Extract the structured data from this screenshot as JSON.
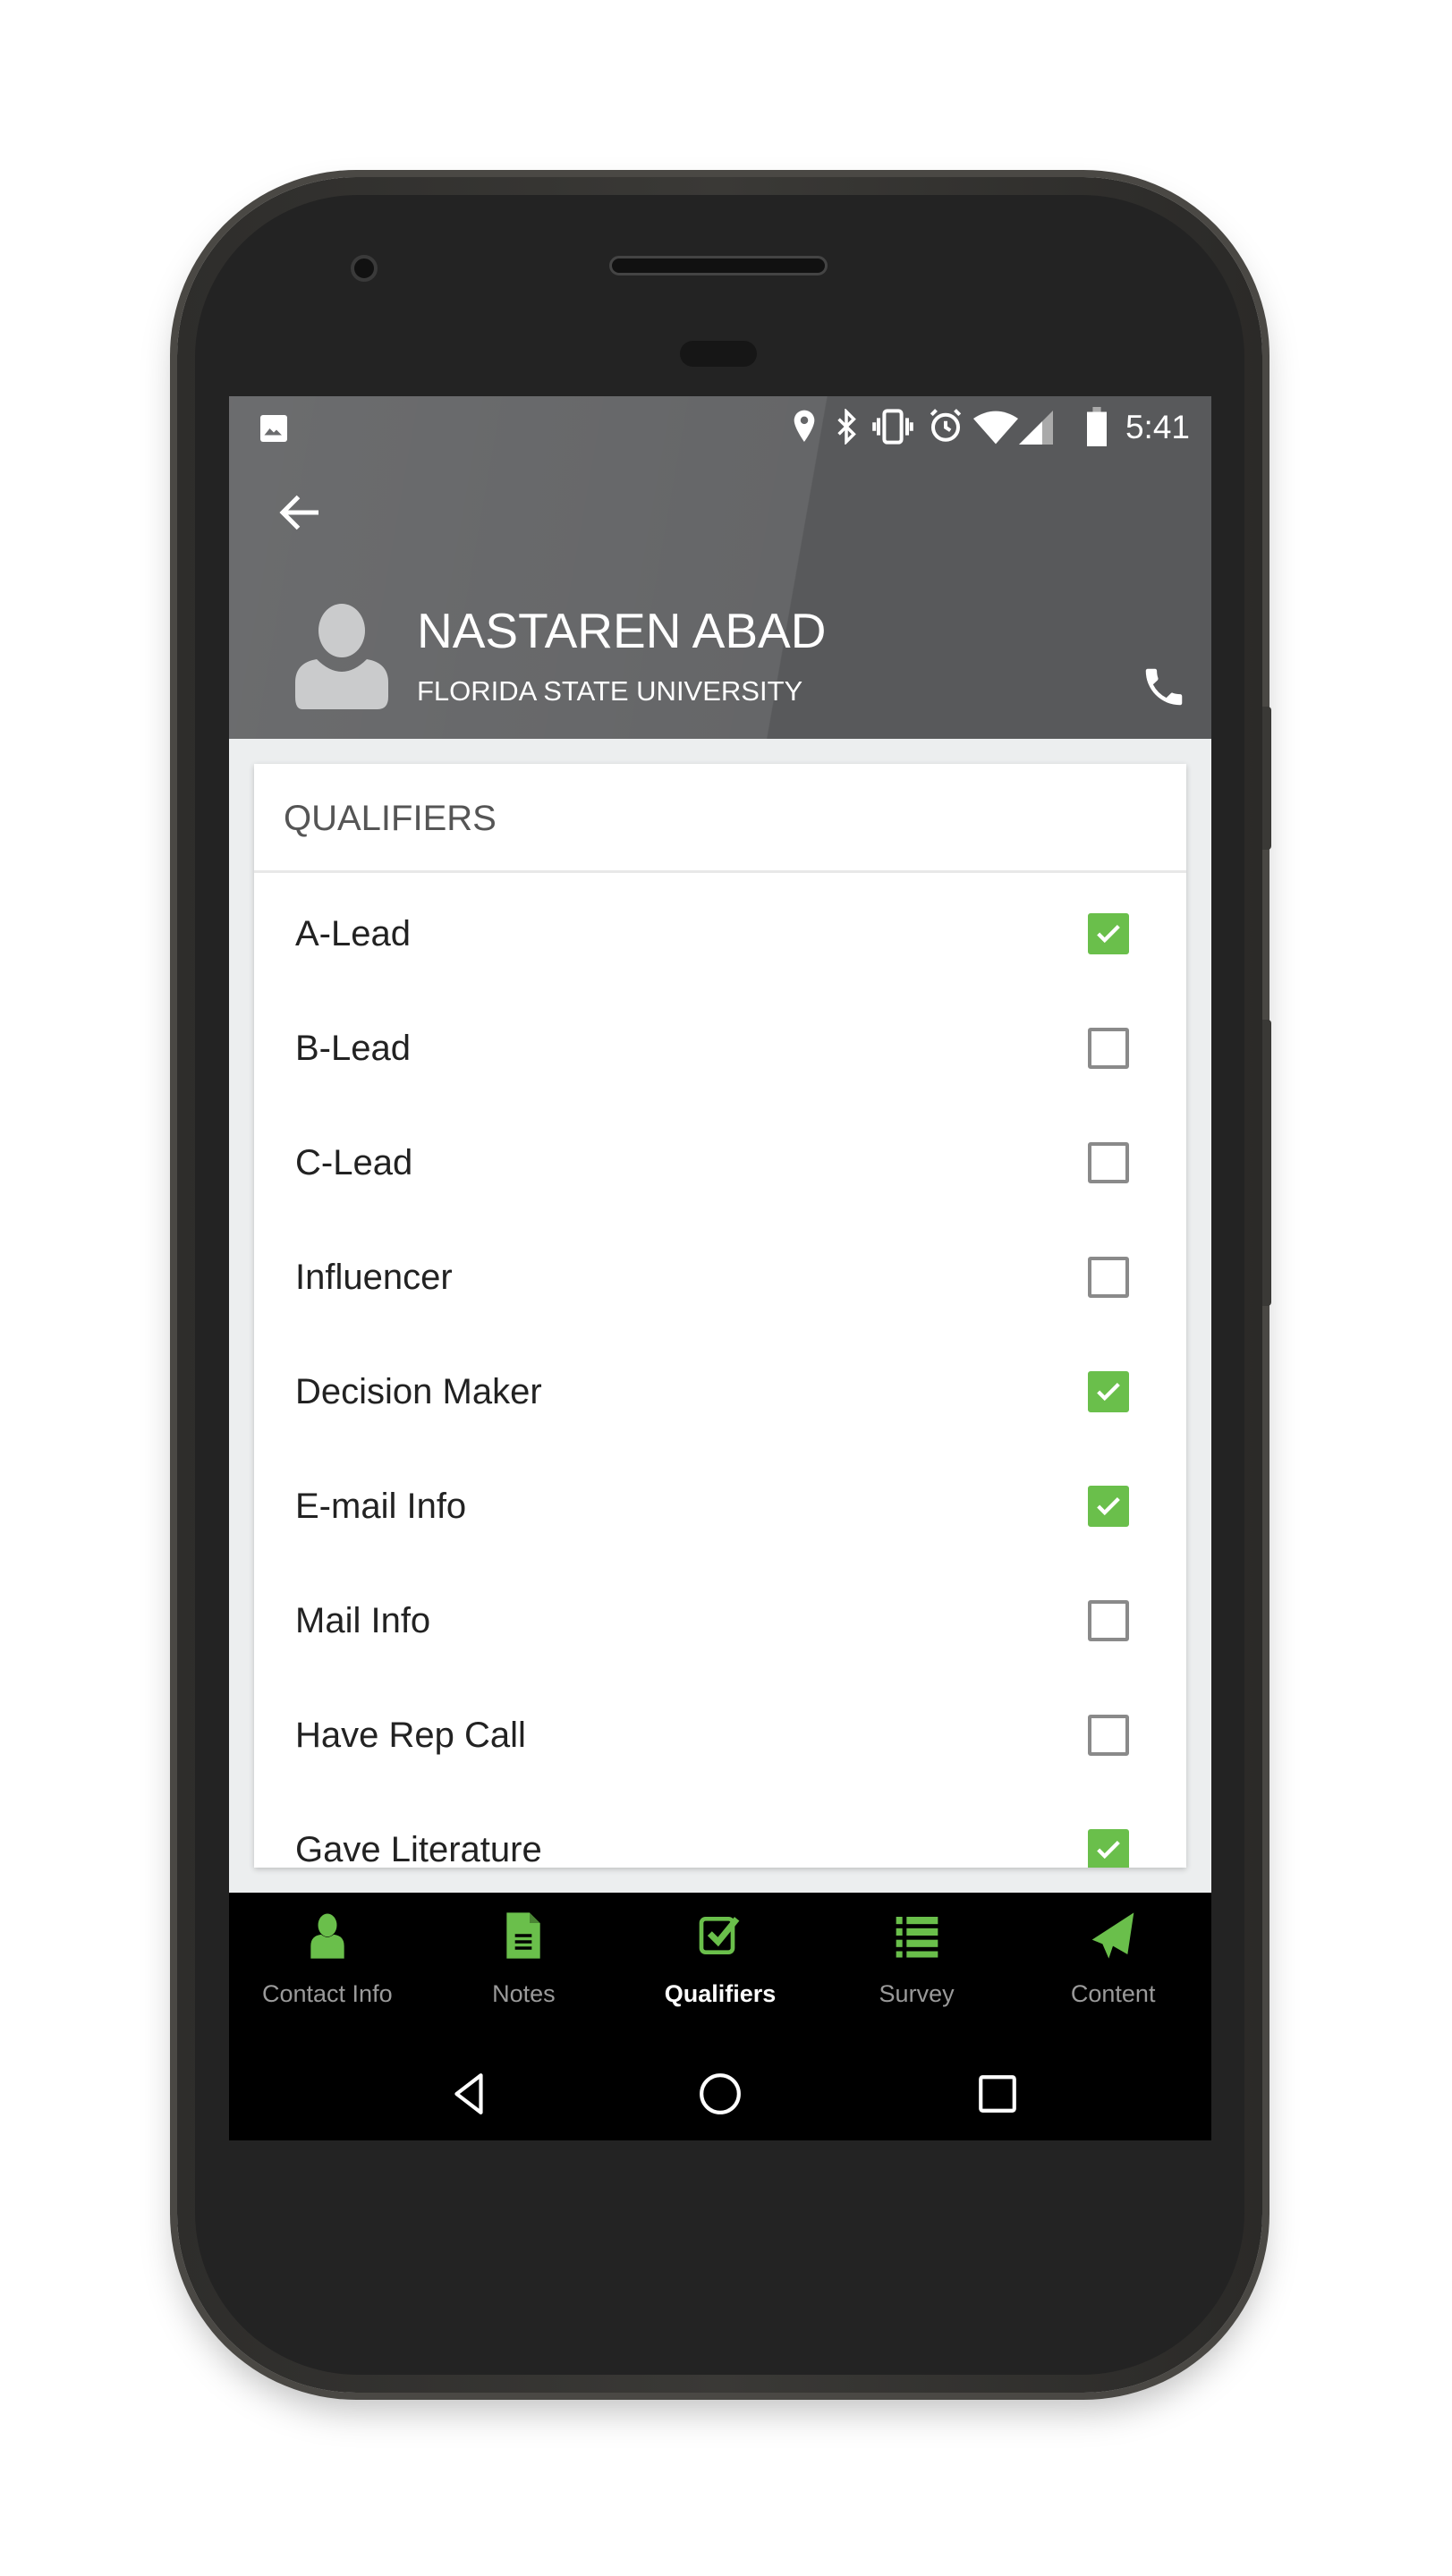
{
  "status_bar": {
    "time": "5:41",
    "icons": [
      "image-icon",
      "location-icon",
      "bluetooth-icon",
      "vibrate-icon",
      "alarm-icon",
      "wifi-icon",
      "signal-icon",
      "battery-icon"
    ]
  },
  "header": {
    "back_icon": "arrow-left-icon",
    "name": "NASTAREN ABAD",
    "organization": "FLORIDA STATE UNIVERSITY",
    "call_icon": "phone-icon"
  },
  "card": {
    "title": "QUALIFIERS",
    "items": [
      {
        "label": "A-Lead",
        "checked": true
      },
      {
        "label": "B-Lead",
        "checked": false
      },
      {
        "label": "C-Lead",
        "checked": false
      },
      {
        "label": "Influencer",
        "checked": false
      },
      {
        "label": "Decision Maker",
        "checked": true
      },
      {
        "label": "E-mail Info",
        "checked": true
      },
      {
        "label": "Mail Info",
        "checked": false
      },
      {
        "label": "Have Rep Call",
        "checked": false
      },
      {
        "label": "Gave Literature",
        "checked": true
      }
    ]
  },
  "bottom_nav": {
    "active": "Qualifiers",
    "accent": "#6abf4b",
    "tabs": [
      {
        "label": "Contact Info",
        "icon": "person-icon"
      },
      {
        "label": "Notes",
        "icon": "document-icon"
      },
      {
        "label": "Qualifiers",
        "icon": "checkbox-icon"
      },
      {
        "label": "Survey",
        "icon": "list-icon"
      },
      {
        "label": "Content",
        "icon": "paper-plane-icon"
      }
    ]
  },
  "colors": {
    "header": "#58595b",
    "accent": "#6abf4b",
    "nav": "#000000"
  }
}
